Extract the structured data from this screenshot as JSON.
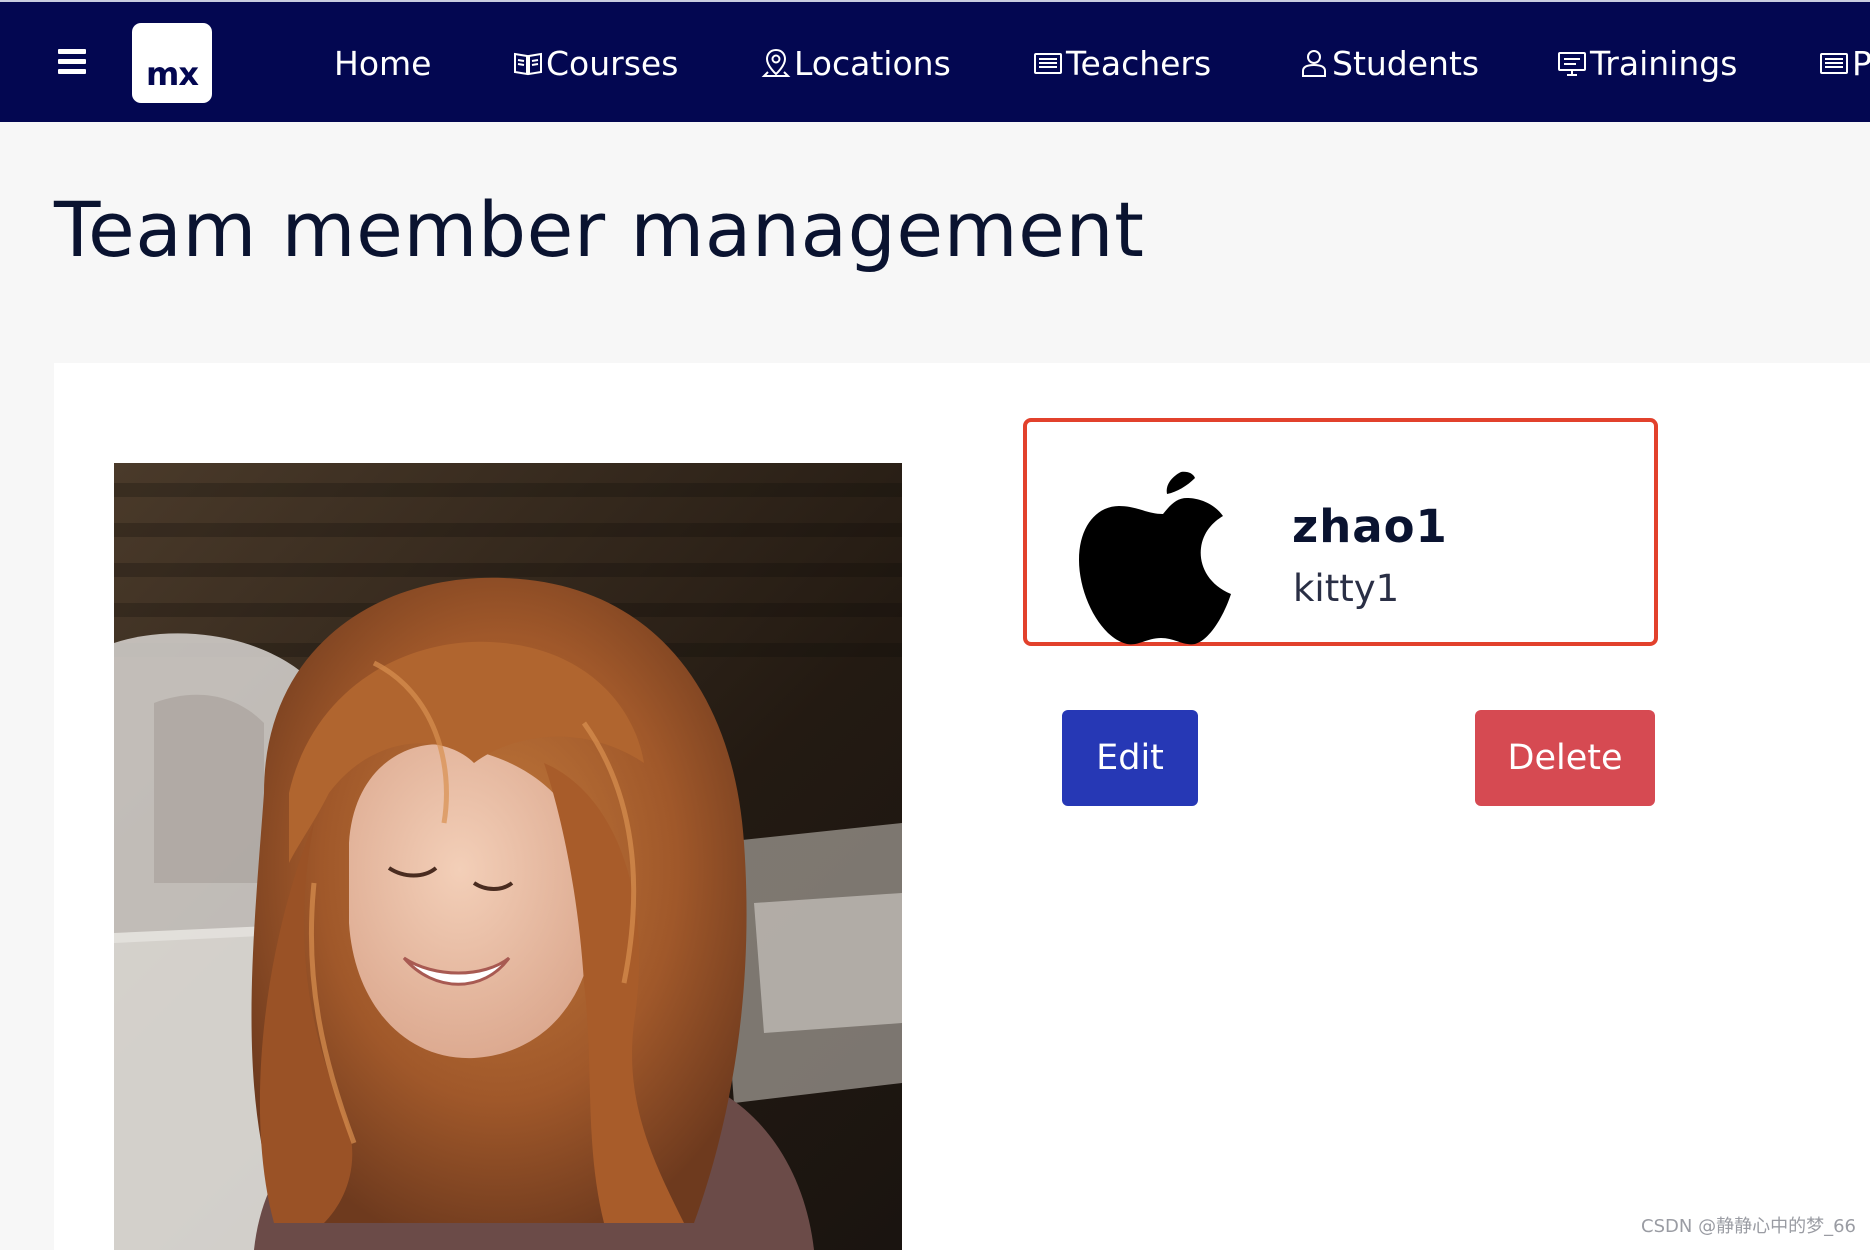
{
  "nav": {
    "logo_text": "mx",
    "items": [
      {
        "label": "Home",
        "icon": "none"
      },
      {
        "label": "Courses",
        "icon": "book-icon"
      },
      {
        "label": "Locations",
        "icon": "map-pin-icon"
      },
      {
        "label": "Teachers",
        "icon": "newspaper-icon"
      },
      {
        "label": "Students",
        "icon": "user-icon"
      },
      {
        "label": "Trainings",
        "icon": "presentation-icon"
      },
      {
        "label": "P",
        "icon": "newspaper-icon"
      }
    ]
  },
  "page": {
    "title": "Team member management"
  },
  "member": {
    "name": "zhao1",
    "username": "kitty1",
    "logo_icon": "apple-logo-icon"
  },
  "actions": {
    "edit_label": "Edit",
    "delete_label": "Delete"
  },
  "watermark": "CSDN @静静心中的梦_66",
  "colors": {
    "nav_background": "#030751",
    "edit_button": "#2638b5",
    "delete_button": "#d64a52",
    "highlight_border": "#e2412c"
  }
}
